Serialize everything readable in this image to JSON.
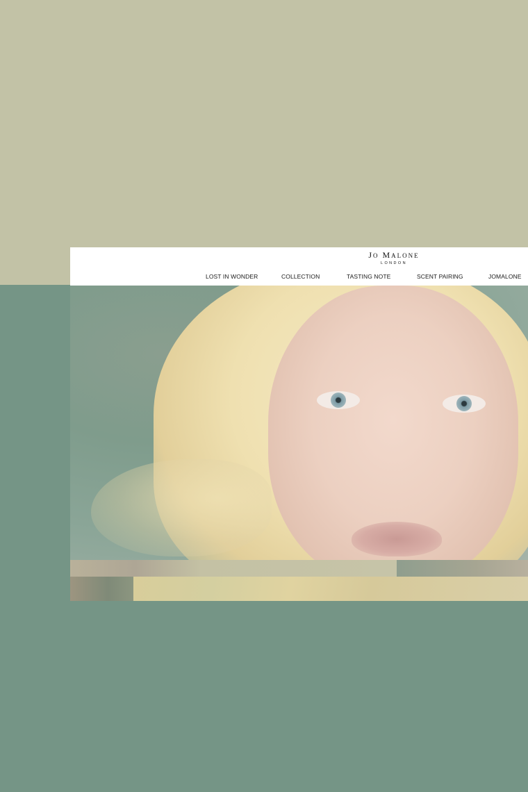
{
  "brand": {
    "name": "Jo Malone",
    "sub": "LONDON"
  },
  "nav": {
    "items": [
      {
        "label": "LOST IN WONDER"
      },
      {
        "label": "COLLECTION"
      },
      {
        "label": "TASTING NOTE"
      },
      {
        "label": "SCENT PAIRING"
      },
      {
        "label": "JOMALONE"
      }
    ]
  },
  "hero": {
    "controls": {
      "prev_icon": "chevron-left-icon",
      "pause_icon": "pause-icon",
      "next_icon": "chevron-right-icon"
    }
  },
  "colors": {
    "top_background": "#c2c2a6",
    "bottom_background": "#759586",
    "header_background": "#ffffff"
  }
}
